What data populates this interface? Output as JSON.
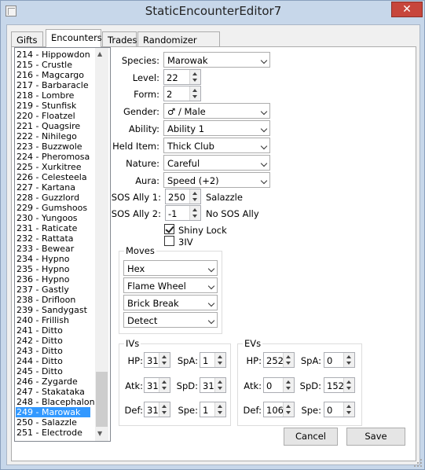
{
  "window": {
    "title": "StaticEncounterEditor7",
    "close_glyph": "✕"
  },
  "tabs": [
    "Gifts",
    "Encounters",
    "Trades",
    "Randomizer Options"
  ],
  "encounter_list": [
    "214 - Hippowdon",
    "215 - Crustle",
    "216 - Magcargo",
    "217 - Barbaracle",
    "218 - Lombre",
    "219 - Stunfisk",
    "220 - Floatzel",
    "221 - Quagsire",
    "222 - Nihilego",
    "223 - Buzzwole",
    "224 - Pheromosa",
    "225 - Xurkitree",
    "226 - Celesteela",
    "227 - Kartana",
    "228 - Guzzlord",
    "229 - Gumshoos",
    "230 - Yungoos",
    "231 - Raticate",
    "232 - Rattata",
    "233 - Bewear",
    "234 - Hypno",
    "235 - Hypno",
    "236 - Hypno",
    "237 - Gastly",
    "238 - Drifloon",
    "239 - Sandygast",
    "240 - Frillish",
    "241 - Ditto",
    "242 - Ditto",
    "243 - Ditto",
    "244 - Ditto",
    "245 - Ditto",
    "246 - Zygarde",
    "247 - Stakataka",
    "248 - Blacephalon",
    "249 - Marowak",
    "250 - Salazzle",
    "251 - Electrode"
  ],
  "selected_index": 35,
  "form": {
    "species_label": "Species:",
    "species": "Marowak",
    "level_label": "Level:",
    "level": "22",
    "form_label": "Form:",
    "form": "2",
    "gender_label": "Gender:",
    "gender": "♂ / Male",
    "ability_label": "Ability:",
    "ability": "Ability 1",
    "held_item_label": "Held Item:",
    "held_item": "Thick Club",
    "nature_label": "Nature:",
    "nature": "Careful",
    "aura_label": "Aura:",
    "aura": "Speed (+2)",
    "sos1_label": "SOS Ally 1:",
    "sos1": "250",
    "sos1_name": "Salazzle",
    "sos2_label": "SOS Ally 2:",
    "sos2": "-1",
    "sos2_name": "No SOS Ally",
    "shiny_lock_label": "Shiny Lock",
    "shiny_lock": true,
    "three_iv_label": "3IV",
    "three_iv": false
  },
  "moves": {
    "label": "Moves",
    "items": [
      "Hex",
      "Flame Wheel",
      "Brick Break",
      "Detect"
    ]
  },
  "ivs": {
    "label": "IVs",
    "hp_label": "HP:",
    "hp": "31",
    "atk_label": "Atk:",
    "atk": "31",
    "def_label": "Def:",
    "def": "31",
    "spa_label": "SpA:",
    "spa": "1",
    "spd_label": "SpD:",
    "spd": "31",
    "spe_label": "Spe:",
    "spe": "1"
  },
  "evs": {
    "label": "EVs",
    "hp_label": "HP:",
    "hp": "252",
    "atk_label": "Atk:",
    "atk": "0",
    "def_label": "Def:",
    "def": "106",
    "spa_label": "SpA:",
    "spa": "0",
    "spd_label": "SpD:",
    "spd": "152",
    "spe_label": "Spe:",
    "spe": "0"
  },
  "buttons": {
    "cancel": "Cancel",
    "save": "Save"
  }
}
